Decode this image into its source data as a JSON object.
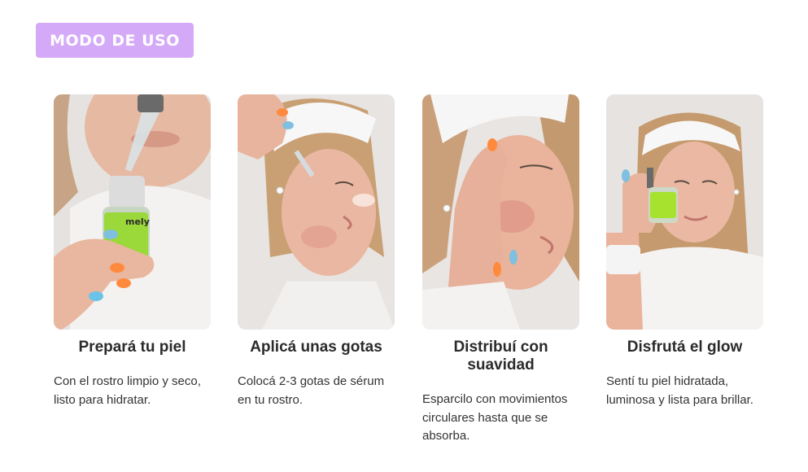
{
  "header": {
    "badge_label": "MODO DE USO",
    "badge_color": "#d4a9f7"
  },
  "steps": [
    {
      "title": "Prepará tu piel",
      "description": "Con el rostro limpio y seco, listo para hidratar."
    },
    {
      "title": "Aplicá unas gotas",
      "description": "Colocá 2-3 gotas de sérum en tu rostro."
    },
    {
      "title": "Distribuí con suavidad",
      "description": "Esparcilo con movimientos circulares hasta que se absorba."
    },
    {
      "title": "Disfrutá el glow",
      "description": "Sentí tu piel hidratada, luminosa y lista para brillar."
    }
  ],
  "product": {
    "brand": "mely",
    "label_color": "#a6e22e"
  }
}
